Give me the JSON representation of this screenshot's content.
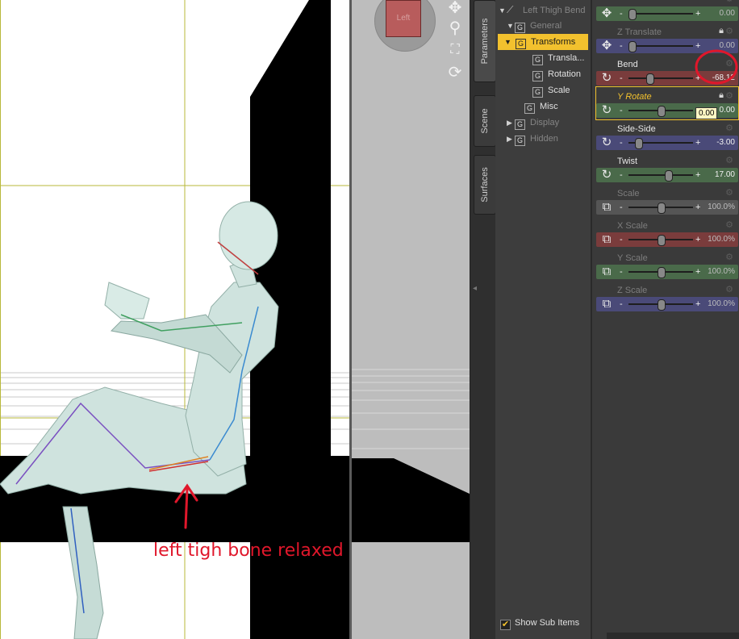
{
  "viewport": {
    "camera_face_label": "Left",
    "annotation": "left tigh bone relaxed"
  },
  "side_tabs": [
    "Parameters",
    "Scene",
    "Surfaces"
  ],
  "tree": {
    "root": "Left Thigh Bend",
    "items": [
      {
        "label": "General"
      },
      {
        "label": "Transforms"
      },
      {
        "label": "Transla..."
      },
      {
        "label": "Rotation"
      },
      {
        "label": "Scale"
      },
      {
        "label": "Misc"
      },
      {
        "label": "Display"
      },
      {
        "label": "Hidden"
      }
    ],
    "icon_letter": "G"
  },
  "show_sub_items": {
    "label": "Show Sub Items",
    "checked": true
  },
  "params": [
    {
      "label": "",
      "value": "0.00",
      "icon": "move-icon",
      "color": "#4a6a4a",
      "knob": 0.05,
      "dim": true
    },
    {
      "label": "Z Translate",
      "value": "0.00",
      "icon": "move-icon",
      "color": "#4a4a78",
      "knob": 0.05,
      "dim": true
    },
    {
      "label": "Bend",
      "value": "-68.12",
      "icon": "rotate-icon",
      "color": "#7a3c3c",
      "knob": 0.32
    },
    {
      "label": "Y Rotate",
      "value": "0.00",
      "icon": "rotate-icon",
      "color": "#4a6a4a",
      "knob": 0.5,
      "dim": true
    },
    {
      "label": "Side-Side",
      "value": "-3.00",
      "icon": "rotate-icon",
      "color": "#4a4a78",
      "knob": 0.15
    },
    {
      "label": "Twist",
      "value": "17.00",
      "icon": "rotate-icon",
      "color": "#4a6a4a",
      "knob": 0.61
    },
    {
      "label": "Scale",
      "value": "100.0%",
      "icon": "scale-icon",
      "color": "#555555",
      "knob": 0.5,
      "dim": true
    },
    {
      "label": "X Scale",
      "value": "100.0%",
      "icon": "scale-icon",
      "color": "#7a3c3c",
      "knob": 0.5,
      "dim": true
    },
    {
      "label": "Y Scale",
      "value": "100.0%",
      "icon": "scale-icon",
      "color": "#4a6a4a",
      "knob": 0.5,
      "dim": true
    },
    {
      "label": "Z Scale",
      "value": "100.0%",
      "icon": "scale-icon",
      "color": "#4a4a78",
      "knob": 0.5,
      "dim": true
    }
  ],
  "tooltip": "0.00",
  "colors": {
    "selection": "#f2c12e",
    "annotation": "#e0172b",
    "panel": "#3a3a3a"
  }
}
